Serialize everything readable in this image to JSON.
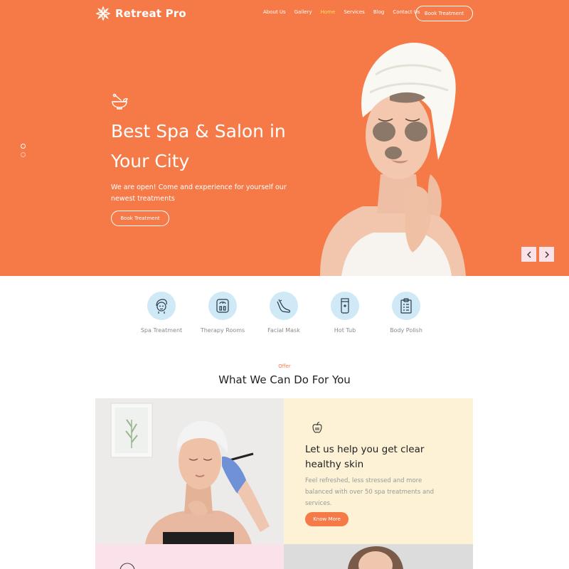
{
  "brand": {
    "name": "Retreat Pro",
    "logo_icon": "lotus-flower-icon"
  },
  "nav": {
    "links": [
      {
        "label": "About Us",
        "active": false
      },
      {
        "label": "Gallery",
        "active": false
      },
      {
        "label": "Home",
        "active": true
      },
      {
        "label": "Services",
        "active": false
      },
      {
        "label": "Blog",
        "active": false
      },
      {
        "label": "Contact Us",
        "active": false
      }
    ],
    "cta_label": "Book Treatment"
  },
  "hero": {
    "icon": "mortar-pestle-icon",
    "title_line1": "Best Spa & Salon in",
    "title_line2": "Your City",
    "subtitle": "We are open! Come and experience for yourself our newest treatments",
    "cta_label": "Book Treatment",
    "slide_count": 2,
    "active_slide": 1,
    "prev_icon": "chevron-left-icon",
    "next_icon": "chevron-right-icon"
  },
  "features": [
    {
      "label": "Spa Treatment",
      "icon": "woman-face-icon"
    },
    {
      "label": "Therapy Rooms",
      "icon": "scale-icon"
    },
    {
      "label": "Facial Mask",
      "icon": "leg-icon"
    },
    {
      "label": "Hot Tub",
      "icon": "cream-tube-icon"
    },
    {
      "label": "Body Polish",
      "icon": "clipboard-icon"
    }
  ],
  "offer": {
    "eyebrow": "Offer",
    "title": "What We Can Do For You",
    "card": {
      "icon": "apple-icon",
      "title": "Let us help you get clear healthy skin",
      "description": "Feel refreshed, less stressed and more balanced with over 50 spa treatments and services.",
      "button_label": "Know More"
    }
  },
  "colors": {
    "accent": "#f57a48",
    "active_nav": "#ffe24a",
    "feature_bg": "#cfe9f7",
    "card_bg": "#fdf1d6",
    "arrow_bg": "#fbe2e8"
  }
}
